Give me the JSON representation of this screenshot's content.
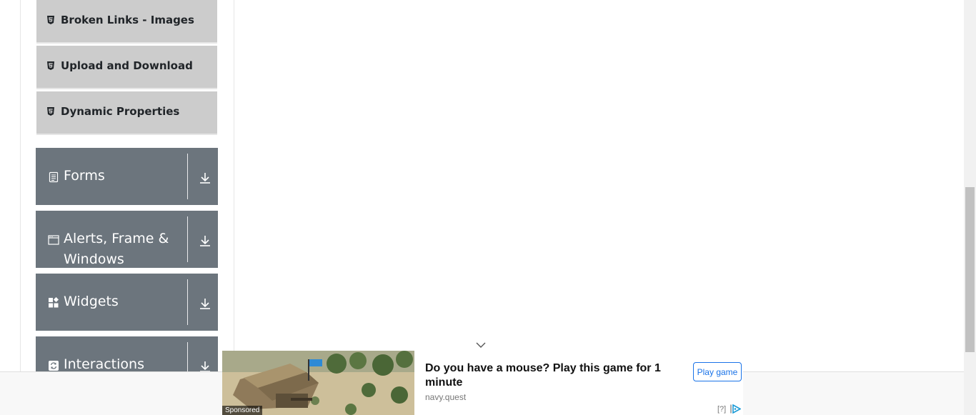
{
  "sidebar": {
    "sub_items": [
      {
        "label": "Broken Links - Images",
        "icon": "html5-icon"
      },
      {
        "label": "Upload and Download",
        "icon": "html5-icon"
      },
      {
        "label": "Dynamic Properties",
        "icon": "html5-icon"
      }
    ],
    "groups": [
      {
        "title": "Forms",
        "icon": "document-icon",
        "toggle_icon": "download-arrow-icon"
      },
      {
        "title": "Alerts, Frame & Windows",
        "icon": "window-icon",
        "toggle_icon": "download-arrow-icon"
      },
      {
        "title": "Widgets",
        "icon": "widgets-icon",
        "toggle_icon": "download-arrow-icon"
      },
      {
        "title": "Interactions",
        "icon": "refresh-icon",
        "toggle_icon": "download-arrow-icon"
      }
    ]
  },
  "ad": {
    "sponsored": "Sponsored",
    "headline": "Do you have a mouse? Play this game for 1 minute",
    "source": "navy.quest",
    "cta": "Play game",
    "help": "[?]",
    "collapse_icon": "chevron-down-icon",
    "adchoices_icon": "adchoices-icon"
  },
  "colors": {
    "group_bg": "#6c757d",
    "sub_item_bg": "#cccccc",
    "cta": "#1a73e8"
  }
}
